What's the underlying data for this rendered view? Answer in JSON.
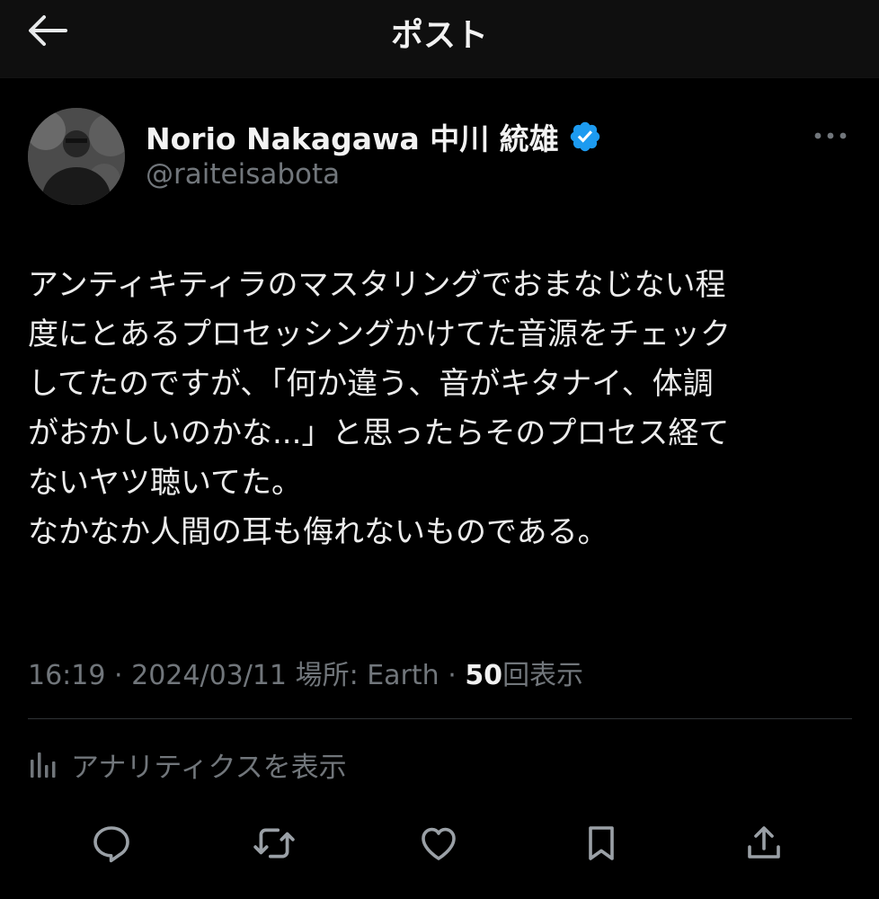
{
  "header": {
    "title": "ポスト"
  },
  "icons": {
    "back": "arrow-left-icon",
    "verified": "verified-badge-icon",
    "more": "more-horizontal-icon",
    "analytics": "bar-chart-icon",
    "reply": "reply-icon",
    "repost": "repost-icon",
    "like": "heart-icon",
    "bookmark": "bookmark-icon",
    "share": "share-icon"
  },
  "colors": {
    "background": "#000000",
    "text": "#e7e9ea",
    "secondary": "#71767b",
    "verified": "#1d9bf0",
    "divider": "#2f3336"
  },
  "author": {
    "name": "Norio Nakagawa 中川 統雄",
    "handle": "@raiteisabota"
  },
  "tweet": {
    "lines": [
      "アンティキティラのマスタリングでおまなじない程",
      "度にとあるプロセッシングかけてた音源をチェック",
      "してたのですが、「何か違う、音がキタナイ、体調",
      "がおかしいのかな...」と思ったらそのプロセス経て",
      "ないヤツ聴いてた。",
      "なかなか人間の耳も侮れないものである。"
    ]
  },
  "meta": {
    "time": "16:19",
    "separator": "·",
    "date": "2024/03/11",
    "location": "場所: Earth",
    "views_count": "50",
    "views_label": "回表示"
  },
  "analytics": {
    "label": "アナリティクスを表示"
  }
}
